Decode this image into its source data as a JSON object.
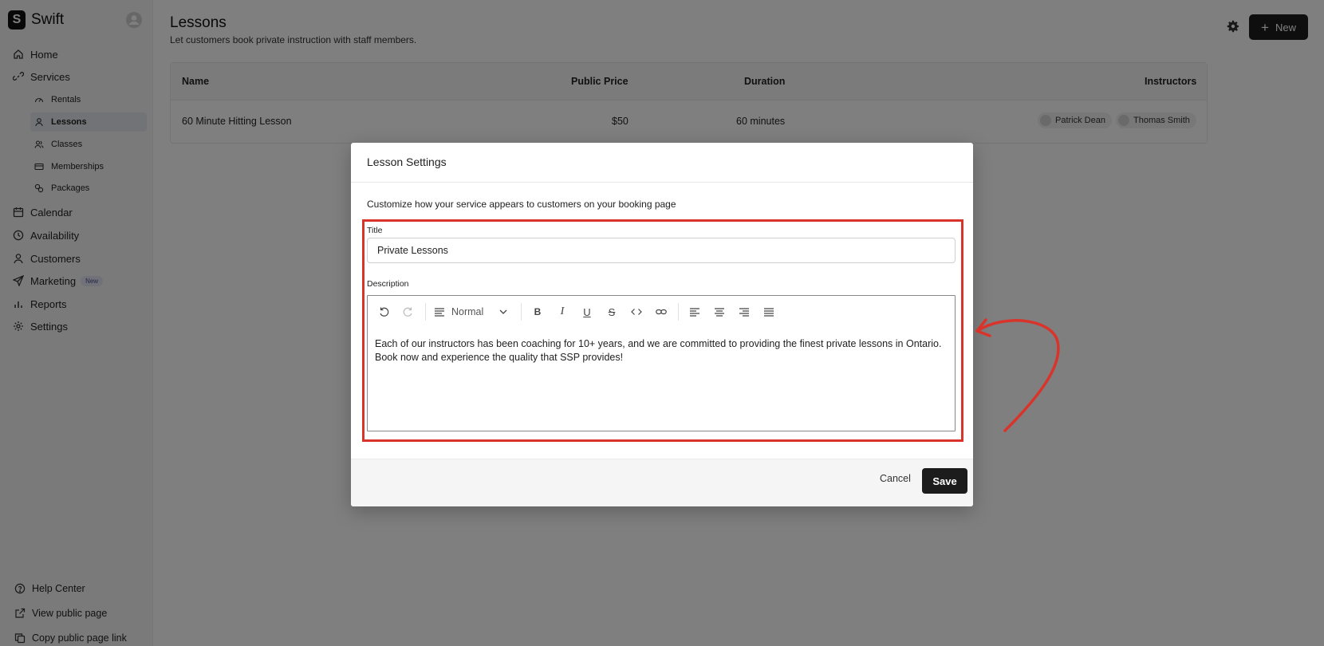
{
  "app": {
    "name": "Swift",
    "logo_letter": "S"
  },
  "sidebar": {
    "items": [
      {
        "label": "Home",
        "icon": "home-icon"
      },
      {
        "label": "Services",
        "icon": "link-icon"
      },
      {
        "label": "Calendar",
        "icon": "calendar-icon"
      },
      {
        "label": "Availability",
        "icon": "clock-icon"
      },
      {
        "label": "Customers",
        "icon": "user-icon"
      },
      {
        "label": "Marketing",
        "icon": "send-icon",
        "badge": "New"
      },
      {
        "label": "Reports",
        "icon": "bar-chart-icon"
      },
      {
        "label": "Settings",
        "icon": "gear-icon"
      }
    ],
    "services_sub": [
      {
        "label": "Rentals",
        "icon": "gauge-icon"
      },
      {
        "label": "Lessons",
        "icon": "user-icon",
        "active": true
      },
      {
        "label": "Classes",
        "icon": "users-icon"
      },
      {
        "label": "Memberships",
        "icon": "card-icon"
      },
      {
        "label": "Packages",
        "icon": "packages-icon"
      }
    ],
    "footer": [
      {
        "label": "Help Center",
        "icon": "help-icon"
      },
      {
        "label": "View public page",
        "icon": "external-link-icon"
      },
      {
        "label": "Copy public page link",
        "icon": "copy-icon"
      }
    ]
  },
  "header": {
    "title": "Lessons",
    "subtitle": "Let customers book private instruction with staff members.",
    "new_label": "New"
  },
  "table": {
    "columns": [
      "Name",
      "Public Price",
      "Duration",
      "Instructors"
    ],
    "rows": [
      {
        "name": "60 Minute Hitting Lesson",
        "price": "$50",
        "duration": "60 minutes",
        "instructors": [
          "Patrick Dean",
          "Thomas Smith"
        ]
      }
    ]
  },
  "modal": {
    "title": "Lesson Settings",
    "description": "Customize how your service appears to customers on your booking page",
    "title_label": "Title",
    "title_value": "Private Lessons",
    "description_label": "Description",
    "block_type": "Normal",
    "body_text": "Each of our instructors has been coaching for 10+ years, and we are committed to providing the finest private lessons in Ontario. Book now and experience the quality that SSP provides!",
    "cancel_label": "Cancel",
    "save_label": "Save"
  },
  "colors": {
    "annotation": "#d9342b",
    "primary_button": "#1c1c1c",
    "overlay": "rgba(0,0,0,0.5)"
  }
}
